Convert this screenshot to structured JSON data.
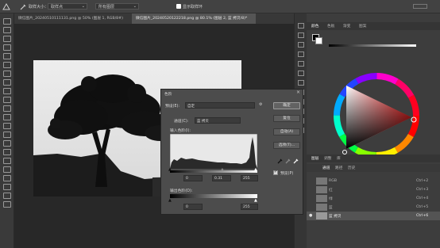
{
  "options_bar": {
    "sample_size_label": "取样大小：",
    "sample_size_value": "取样点",
    "sample_option_label": "所有图层",
    "show_ring_label": "显示取样环"
  },
  "doc_tabs": [
    {
      "title": "微信图片_20240510111131.png @ 50% (图层 1, RGB/8#)",
      "active": false
    },
    {
      "title": "微信图片_20240520122218.png @ 80.1% (图层 2, 蓝 拷贝/8)*",
      "active": true
    }
  ],
  "color_panel": {
    "tabs": [
      "颜色",
      "色板",
      "渐变",
      "图案"
    ]
  },
  "channels_panel": {
    "tabs": [
      "图层",
      "调整",
      "库"
    ],
    "subtabs": [
      "通道",
      "路径",
      "历史"
    ],
    "rows": [
      {
        "name": "RGB",
        "shortcut": "Ctrl+2",
        "visible": false
      },
      {
        "name": "红",
        "shortcut": "Ctrl+3",
        "visible": false
      },
      {
        "name": "绿",
        "shortcut": "Ctrl+4",
        "visible": false
      },
      {
        "name": "蓝",
        "shortcut": "Ctrl+5",
        "visible": false
      },
      {
        "name": "蓝 拷贝",
        "shortcut": "Ctrl+6",
        "visible": true
      }
    ]
  },
  "levels_dialog": {
    "title": "色阶",
    "preset_label": "预设(E):",
    "preset_value": "自定",
    "channel_label": "通道(C):",
    "channel_value": "蓝 拷贝",
    "input_label": "输入色阶(I):",
    "input_black": "0",
    "input_gamma": "0.31",
    "input_white": "255",
    "output_label": "输出色阶(O):",
    "output_black": "0",
    "output_white": "255",
    "ok_button": "确定",
    "reset_button": "复位",
    "auto_button": "自动(A)",
    "options_button": "选项(T)...",
    "preview_label": "预览(P)",
    "preview_checked": true
  },
  "colors": {
    "ui_dark": "#2b2b2b",
    "panel": "#3d3d3d",
    "dialog": "#4c4c4c",
    "accent_red": "#ff1e1e"
  }
}
